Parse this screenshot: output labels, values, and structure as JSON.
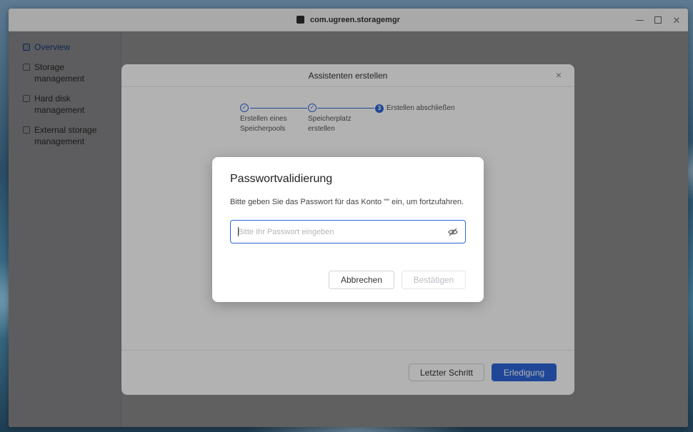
{
  "window": {
    "title": "com.ugreen.storagemgr",
    "minimize_icon": "minimize-icon",
    "maximize_icon": "maximize-icon",
    "close_icon": "close-icon"
  },
  "sidebar": {
    "items": [
      {
        "label": "Overview",
        "icon": "overview-icon",
        "active": true
      },
      {
        "label": "Storage management",
        "icon": "storage-icon",
        "active": false
      },
      {
        "label": "Hard disk management",
        "icon": "hard-disk-icon",
        "active": false
      },
      {
        "label": "External storage management",
        "icon": "external-storage-icon",
        "active": false
      }
    ]
  },
  "wizard": {
    "title": "Assistenten erstellen",
    "close": "×",
    "steps": [
      {
        "label": "Erstellen eines Speicherpools",
        "state": "done"
      },
      {
        "label": "Speicherplatz erstellen",
        "state": "done"
      },
      {
        "number": "3",
        "label": "Erstellen abschließen",
        "state": "current"
      }
    ],
    "back_label": "Letzter Schritt",
    "finish_label": "Erledigung"
  },
  "password_dialog": {
    "title": "Passwortvalidierung",
    "description": "Bitte geben Sie das Passwort für das Konto \"\" ein, um fortzufahren.",
    "input": {
      "value": "",
      "placeholder": "Bitte Ihr Passwort eingeben"
    },
    "toggle_icon": "eye-hidden-icon",
    "cancel_label": "Abbrechen",
    "confirm_label": "Bestätigen"
  },
  "colors": {
    "accent": "#2e66d9",
    "overlay": "rgba(0,0,0,0.45)"
  }
}
